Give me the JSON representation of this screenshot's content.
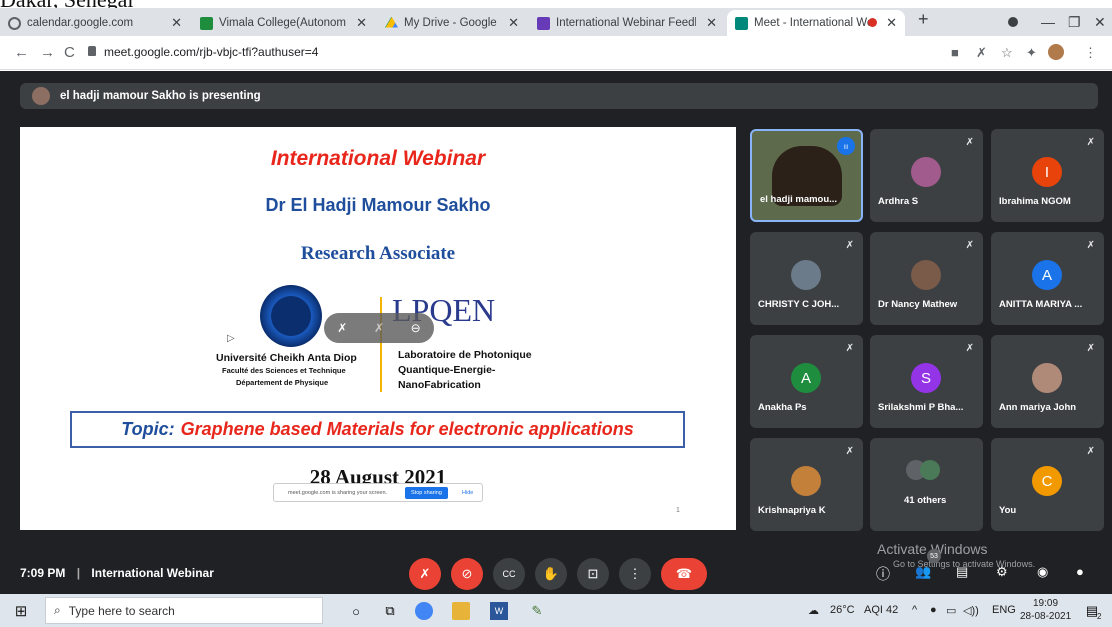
{
  "page_top_text": "Dakar, Senegal",
  "tabs": [
    {
      "label": "calendar.google.com",
      "icon": "globe-icon",
      "color": "#5f6368"
    },
    {
      "label": "Vimala College(Autonomous)",
      "icon": "classroom-icon",
      "color": "#1e8e3e"
    },
    {
      "label": "My Drive - Google Drive",
      "icon": "drive-icon",
      "color": "#fbbc04"
    },
    {
      "label": "International Webinar Feedback",
      "icon": "forms-icon",
      "color": "#673ab7"
    },
    {
      "label": "Meet - International Webinar",
      "icon": "meet-icon",
      "color": "#00897b"
    }
  ],
  "address": {
    "url": "meet.google.com/rjb-vbjc-tfi?authuser=4"
  },
  "presenting": "el hadji mamour Sakho is presenting",
  "slide": {
    "heading": "International Webinar",
    "speaker": "Dr El Hadji Mamour Sakho",
    "role": "Research Associate",
    "lab_logo": "LPQEN",
    "univ_name": "Université Cheikh Anta Diop",
    "univ_faculty": "Faculté des Sciences et Technique",
    "univ_dept": "Département de Physique",
    "lab_line1": "Laboratoire de Photonique",
    "lab_line2": "Quantique-Energie-",
    "lab_line3": "NanoFabrication",
    "topic_label": "Topic:",
    "topic_text": "Graphene based Materials for electronic applications",
    "date": "28 August 2021",
    "page_num": "1"
  },
  "share_popup": {
    "text": "meet.google.com is sharing your screen.",
    "stop": "Stop sharing",
    "hide": "Hide"
  },
  "participants": [
    {
      "name": "el hadji mamou...",
      "type": "video",
      "color": "#6a7a5c"
    },
    {
      "name": "Ardhra S",
      "type": "photo",
      "color": "#a15b8c"
    },
    {
      "name": "Ibrahima NGOM",
      "type": "letter",
      "letter": "I",
      "color": "#e8430a"
    },
    {
      "name": "CHRISTY C JOH...",
      "type": "photo",
      "color": "#6b7b8a"
    },
    {
      "name": "Dr Nancy Mathew",
      "type": "photo",
      "color": "#7a5a48"
    },
    {
      "name": "ANITTA MARIYA ...",
      "type": "letter",
      "letter": "A",
      "color": "#1a73e8"
    },
    {
      "name": "Anakha Ps",
      "type": "letter",
      "letter": "A",
      "color": "#1e8e3e"
    },
    {
      "name": "Srilakshmi P Bha...",
      "type": "letter",
      "letter": "S",
      "color": "#9334e6"
    },
    {
      "name": "Ann mariya John",
      "type": "photo",
      "color": "#b08a78"
    },
    {
      "name": "Krishnapriya K",
      "type": "photo",
      "color": "#c2803a"
    },
    {
      "name": "41 others",
      "type": "others",
      "color": "#5f6368"
    },
    {
      "name": "You",
      "type": "letter",
      "letter": "C",
      "color": "#f29900"
    }
  ],
  "meeting": {
    "time": "7:09 PM",
    "title": "International Webinar",
    "participant_count": "53"
  },
  "activate": {
    "title": "Activate Windows",
    "subtitle": "Go to Settings to activate Windows."
  },
  "taskbar": {
    "search_placeholder": "Type here to search",
    "weather": "26°C",
    "aqi": "AQI 42",
    "lang": "ENG",
    "clock_time": "19:09",
    "clock_date": "28-08-2021",
    "notif_count": "2"
  }
}
